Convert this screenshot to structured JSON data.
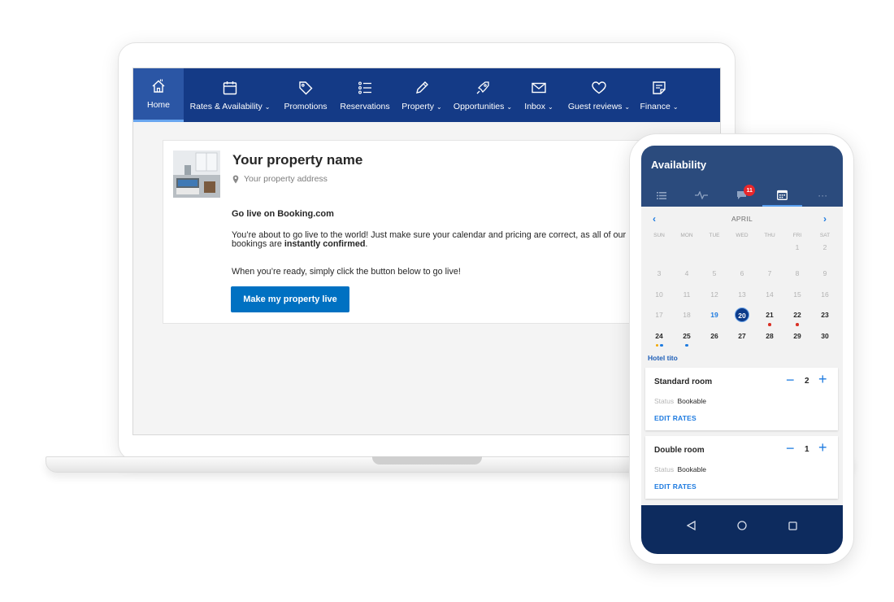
{
  "laptop": {
    "nav": [
      {
        "id": "home",
        "label": "Home",
        "icon": "home-icon",
        "chevron": false,
        "active": true
      },
      {
        "id": "rates",
        "label": "Rates & Availability",
        "icon": "calendar-icon",
        "chevron": true
      },
      {
        "id": "promotions",
        "label": "Promotions",
        "icon": "tag-icon",
        "chevron": false
      },
      {
        "id": "reservations",
        "label": "Reservations",
        "icon": "list-icon",
        "chevron": false
      },
      {
        "id": "property",
        "label": "Property",
        "icon": "pencil-icon",
        "chevron": true
      },
      {
        "id": "opportunities",
        "label": "Opportunities",
        "icon": "rocket-icon",
        "chevron": true
      },
      {
        "id": "inbox",
        "label": "Inbox",
        "icon": "envelope-icon",
        "chevron": true
      },
      {
        "id": "reviews",
        "label": "Guest reviews",
        "icon": "heart-icon",
        "chevron": true
      },
      {
        "id": "finance",
        "label": "Finance",
        "icon": "document-icon",
        "chevron": true
      }
    ],
    "chevron_glyph": "⌄",
    "card": {
      "title": "Your property name",
      "address": "Your property address",
      "golive_heading": "Go live on Booking.com",
      "golive_text_1": "You’re about to go live to the world! Just make sure your calendar and pricing are correct, as all of our bookings are ",
      "golive_text_bold": "instantly confirmed",
      "golive_text_2": ".",
      "golive_ready": "When you’re ready, simply click the button below to go live!",
      "button_label": "Make my property live"
    }
  },
  "phone": {
    "title": "Availability",
    "tabs": [
      {
        "icon": "list-icon"
      },
      {
        "icon": "activity-icon"
      },
      {
        "icon": "chat-icon",
        "badge": "11"
      },
      {
        "icon": "calendar-icon",
        "active": true
      },
      {
        "icon": "more-icon",
        "glyph": "···"
      }
    ],
    "calendar": {
      "prev": "‹",
      "next": "›",
      "month": "APRIL",
      "weekdays": [
        "SUN",
        "MON",
        "TUE",
        "WED",
        "THU",
        "FRI",
        "SAT"
      ],
      "weeks": [
        [
          "",
          "",
          "",
          "",
          "",
          "1",
          "2"
        ],
        [
          "3",
          "4",
          "5",
          "6",
          "7",
          "8",
          "9"
        ],
        [
          "10",
          "11",
          "12",
          "13",
          "14",
          "15",
          "16"
        ],
        [
          "17",
          "18",
          "19",
          "20",
          "21",
          "22",
          "23"
        ],
        [
          "24",
          "25",
          "26",
          "27",
          "28",
          "29",
          "30"
        ]
      ],
      "today": "19",
      "selected": "20",
      "bold_from": "20",
      "dots": {
        "21": [
          "red"
        ],
        "22": [
          "red"
        ],
        "24": [
          "orange",
          "blue"
        ],
        "25": [
          "blue"
        ]
      }
    },
    "hotel_name": "Hotel tito",
    "rooms": [
      {
        "name": "Standard room",
        "minus": "−",
        "qty": "2",
        "plus": "+",
        "status_label": "Status",
        "status": "Bookable",
        "edit": "EDIT RATES"
      },
      {
        "name": "Double room",
        "minus": "−",
        "qty": "1",
        "plus": "+",
        "status_label": "Status",
        "status": "Bookable",
        "edit": "EDIT RATES"
      }
    ],
    "navbar": [
      {
        "icon": "back-icon"
      },
      {
        "icon": "home-circle-icon"
      },
      {
        "icon": "recents-icon"
      }
    ]
  },
  "colors": {
    "nav_bg": "#143a86",
    "nav_active": "#2b56a5",
    "primary_button": "#0071c2",
    "phone_header": "#2b4b7d",
    "phone_navbar": "#0d2b5e",
    "link_blue": "#1e7be0",
    "badge_red": "#e8272b"
  }
}
